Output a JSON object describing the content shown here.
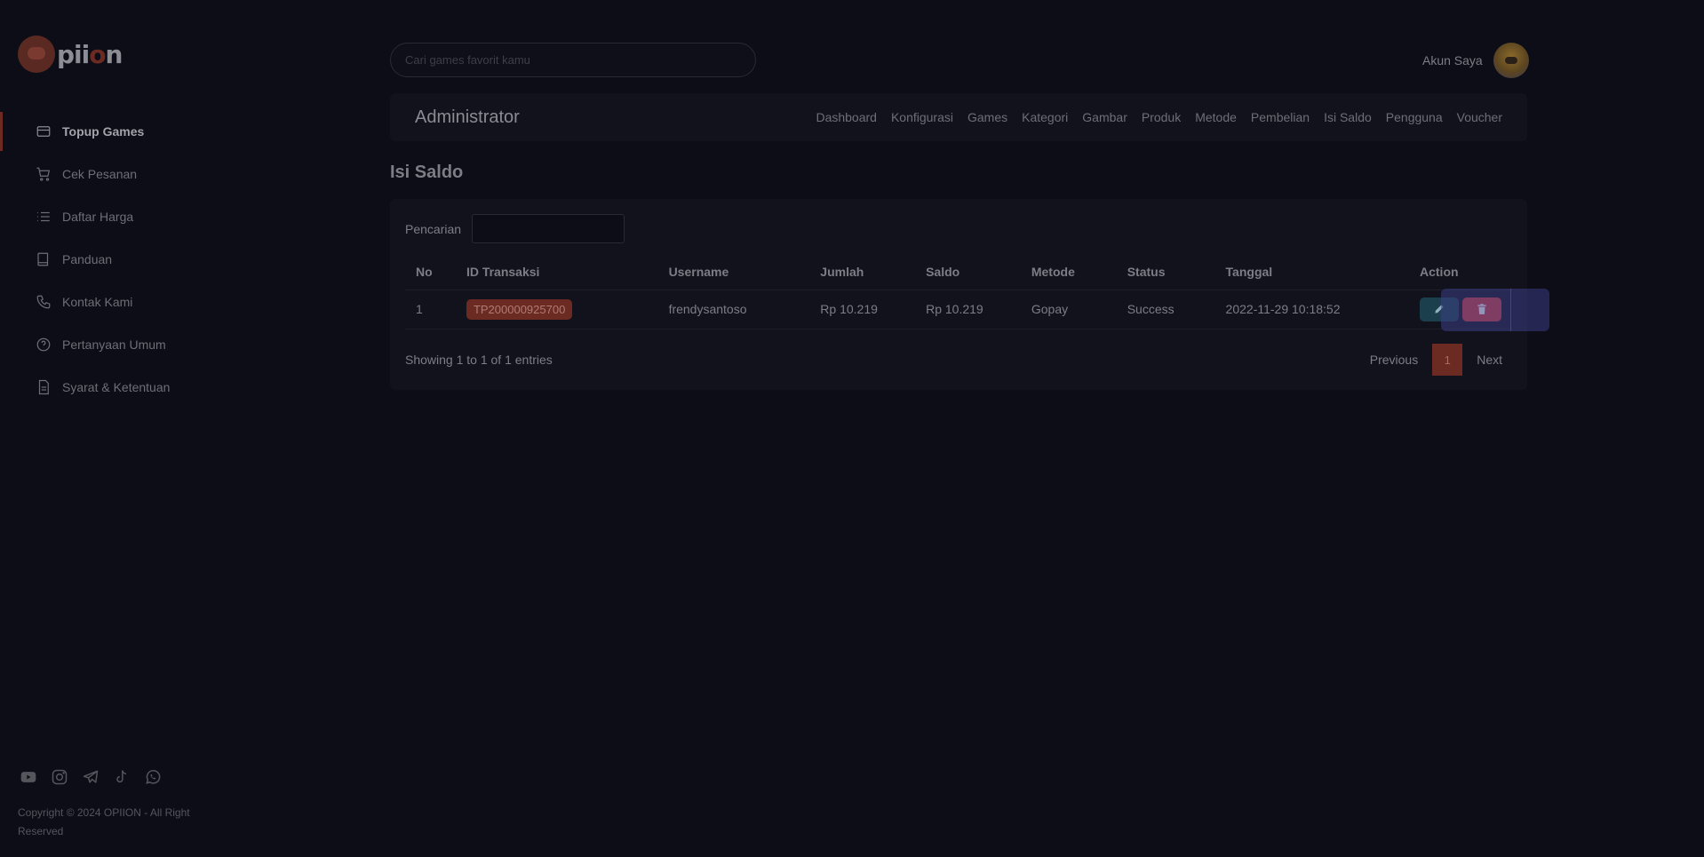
{
  "brand": {
    "logo_text_a": "pii",
    "logo_text_b": "o",
    "logo_text_c": "n"
  },
  "sidebar": {
    "items": [
      {
        "label": "Topup Games",
        "icon": "credit-card-icon",
        "active": true
      },
      {
        "label": "Cek Pesanan",
        "icon": "cart-icon"
      },
      {
        "label": "Daftar Harga",
        "icon": "list-icon"
      },
      {
        "label": "Panduan",
        "icon": "book-icon"
      },
      {
        "label": "Kontak Kami",
        "icon": "phone-icon"
      },
      {
        "label": "Pertanyaan Umum",
        "icon": "question-icon"
      },
      {
        "label": "Syarat & Ketentuan",
        "icon": "document-icon"
      }
    ],
    "socials": [
      "youtube-icon",
      "instagram-icon",
      "telegram-icon",
      "tiktok-icon",
      "whatsapp-icon"
    ],
    "copyright": "Copyright © 2024 OPIION - All Right Reserved"
  },
  "topbar": {
    "search_placeholder": "Cari games favorit kamu",
    "account_label": "Akun Saya"
  },
  "admin": {
    "title": "Administrator",
    "nav": [
      "Dashboard",
      "Konfigurasi",
      "Games",
      "Kategori",
      "Gambar",
      "Produk",
      "Metode",
      "Pembelian",
      "Isi Saldo",
      "Pengguna",
      "Voucher"
    ]
  },
  "page": {
    "title": "Isi Saldo"
  },
  "filter": {
    "label": "Pencarian",
    "value": ""
  },
  "table": {
    "headers": [
      "No",
      "ID Transaksi",
      "Username",
      "Jumlah",
      "Saldo",
      "Metode",
      "Status",
      "Tanggal",
      "Action"
    ],
    "rows": [
      {
        "no": "1",
        "id": "TP200000925700",
        "username": "frendysantoso",
        "jumlah": "Rp 10.219",
        "saldo": "Rp 10.219",
        "metode": "Gopay",
        "status": "Success",
        "tanggal": "2022-11-29 10:18:52"
      }
    ]
  },
  "pagination": {
    "info": "Showing 1 to 1 of 1 entries",
    "previous": "Previous",
    "page": "1",
    "next": "Next"
  },
  "colors": {
    "accent": "#6b2a22",
    "danger": "#d63c3c",
    "edit": "#1c3f4d",
    "background": "#0d0d17",
    "card": "#12121d"
  }
}
